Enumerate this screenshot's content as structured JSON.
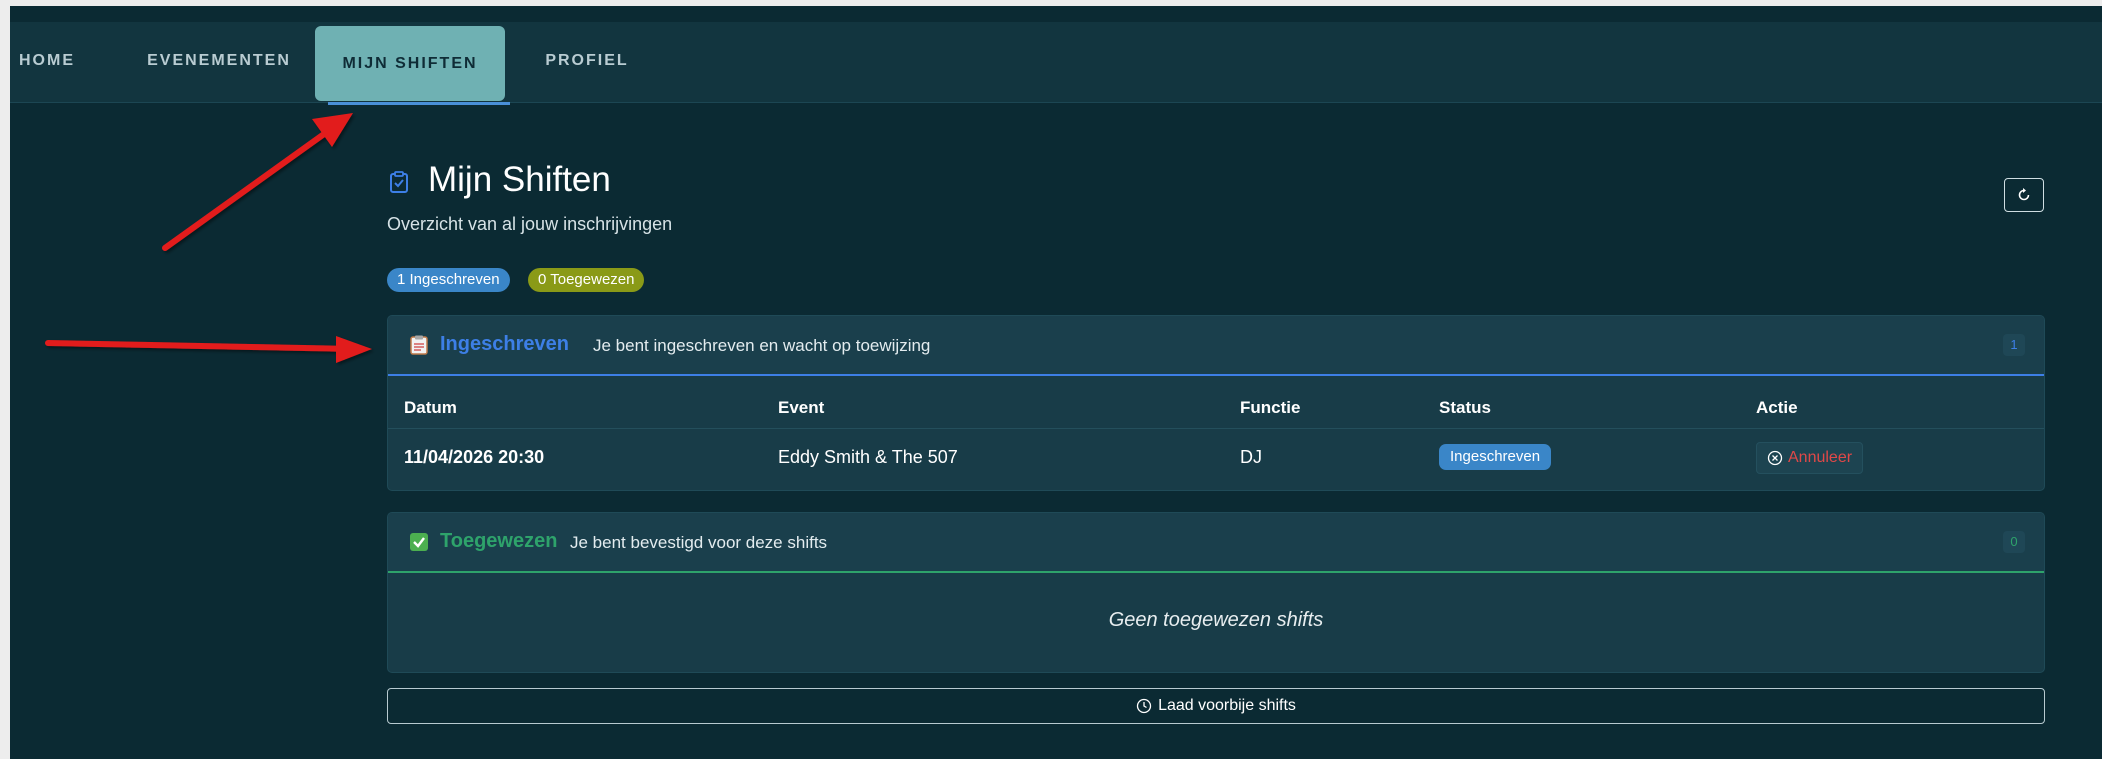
{
  "nav": {
    "items": [
      {
        "label": "HOME"
      },
      {
        "label": "EVENEMENTEN"
      },
      {
        "label": "MIJN SHIFTEN"
      },
      {
        "label": "PROFIEL"
      }
    ],
    "active": "MIJN SHIFTEN"
  },
  "header": {
    "title": "Mijn Shiften",
    "subtitle": "Overzicht van al jouw inschrijvingen"
  },
  "badges": {
    "registered": "1 Ingeschreven",
    "assigned": "0 Toegewezen"
  },
  "registered_card": {
    "icon": "clipboard-icon",
    "title": "Ingeschreven",
    "description": "Je bent ingeschreven en wacht op toewijzing",
    "count": "1",
    "columns": [
      "Datum",
      "Event",
      "Functie",
      "Status",
      "Actie"
    ],
    "rows": [
      {
        "datum": "11/04/2026 20:30",
        "event": "Eddy Smith & The 507",
        "functie": "DJ",
        "status": "Ingeschreven",
        "actie": "Annuleer"
      }
    ]
  },
  "assigned_card": {
    "icon": "check-box-icon",
    "title": "Toegewezen",
    "description": "Je bent bevestigd voor deze shifts",
    "count": "0",
    "empty_text": "Geen toegewezen shifts"
  },
  "load_past_label": "Laad voorbije shifts",
  "colors": {
    "background": "#0b2a33",
    "registered_accent": "#3d7fe6",
    "assigned_accent": "#2ea36b",
    "cancel": "#e04848",
    "annotation_arrow": "#e21b1b"
  }
}
